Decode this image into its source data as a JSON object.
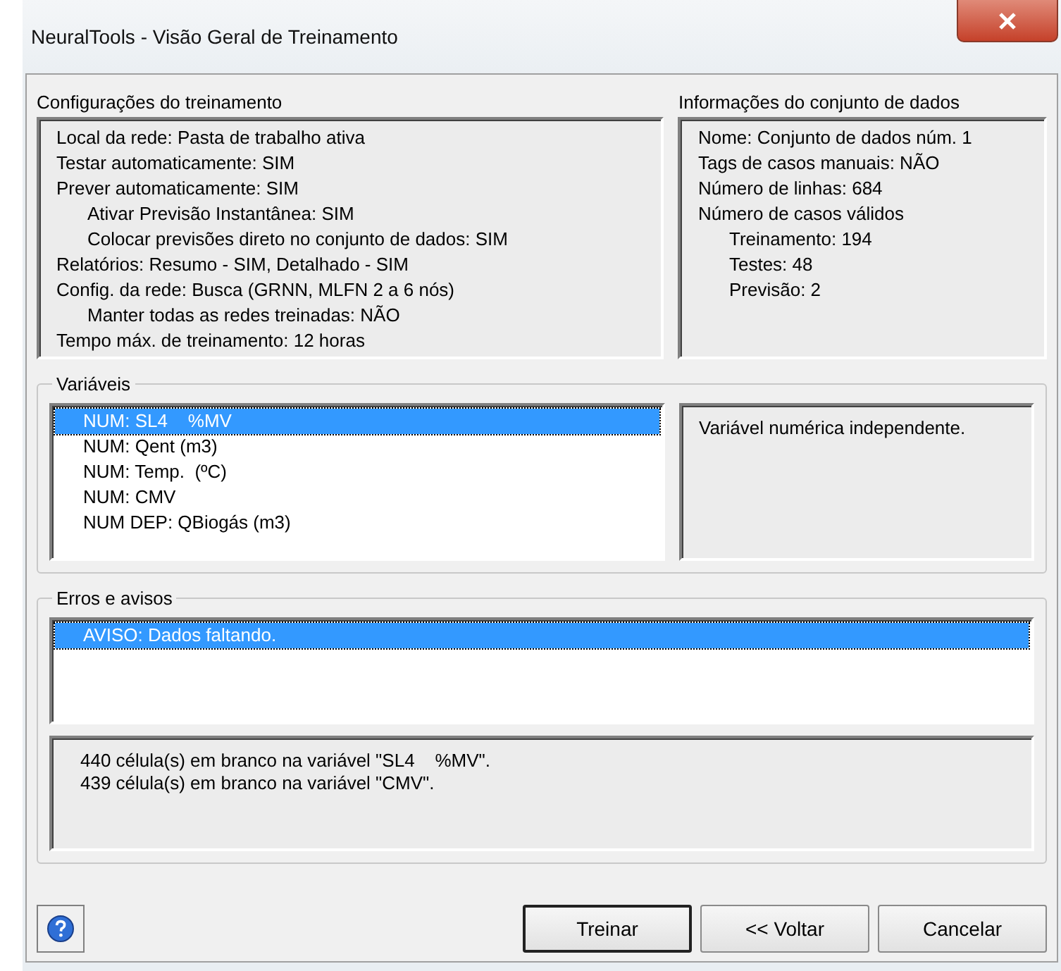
{
  "window": {
    "title": "NeuralTools - Visão Geral de Treinamento"
  },
  "training_settings": {
    "title": "Configurações do treinamento",
    "lines": [
      {
        "text": "Local da rede: Pasta de trabalho ativa"
      },
      {
        "text": "Testar automaticamente: SIM"
      },
      {
        "text": "Prever automaticamente: SIM",
        "children": [
          {
            "text": "Ativar Previsão Instantânea: SIM"
          },
          {
            "text": "Colocar previsões direto no conjunto de dados: SIM"
          }
        ]
      },
      {
        "text": "Relatórios: Resumo - SIM, Detalhado - SIM"
      },
      {
        "text": "Config. da rede: Busca (GRNN, MLFN 2 a 6 nós)",
        "children": [
          {
            "text": "Manter todas as redes treinadas: NÃO"
          }
        ]
      },
      {
        "text": "Tempo máx. de treinamento: 12 horas"
      }
    ]
  },
  "dataset_info": {
    "title": "Informações do conjunto de dados",
    "lines": [
      {
        "text": "Nome: Conjunto de dados núm. 1"
      },
      {
        "text": "Tags de casos manuais: NÃO"
      },
      {
        "text": "Número de linhas: 684"
      },
      {
        "text": "Número de casos válidos",
        "children": [
          {
            "text": "Treinamento: 194"
          },
          {
            "text": "Testes: 48"
          },
          {
            "text": "Previsão: 2"
          }
        ]
      }
    ]
  },
  "variables": {
    "title": "Variáveis",
    "items": [
      {
        "label": "NUM: SL4    %MV",
        "selected": true
      },
      {
        "label": "NUM: Qent (m3)",
        "selected": false
      },
      {
        "label": "NUM: Temp.  (ºC)",
        "selected": false
      },
      {
        "label": "NUM: CMV",
        "selected": false
      },
      {
        "label": "NUM DEP: QBiogás (m3)",
        "selected": false
      }
    ],
    "description": "Variável numérica independente."
  },
  "errors": {
    "title": "Erros e avisos",
    "items": [
      {
        "label": "AVISO: Dados faltando.",
        "selected": true
      }
    ],
    "details": [
      "440 célula(s) em branco na variável \"SL4    %MV\".",
      "439 célula(s) em branco na variável \"CMV\"."
    ]
  },
  "buttons": [
    {
      "label": "Treinar",
      "default": true
    },
    {
      "label": "<< Voltar",
      "default": false
    },
    {
      "label": "Cancelar",
      "default": false
    }
  ]
}
